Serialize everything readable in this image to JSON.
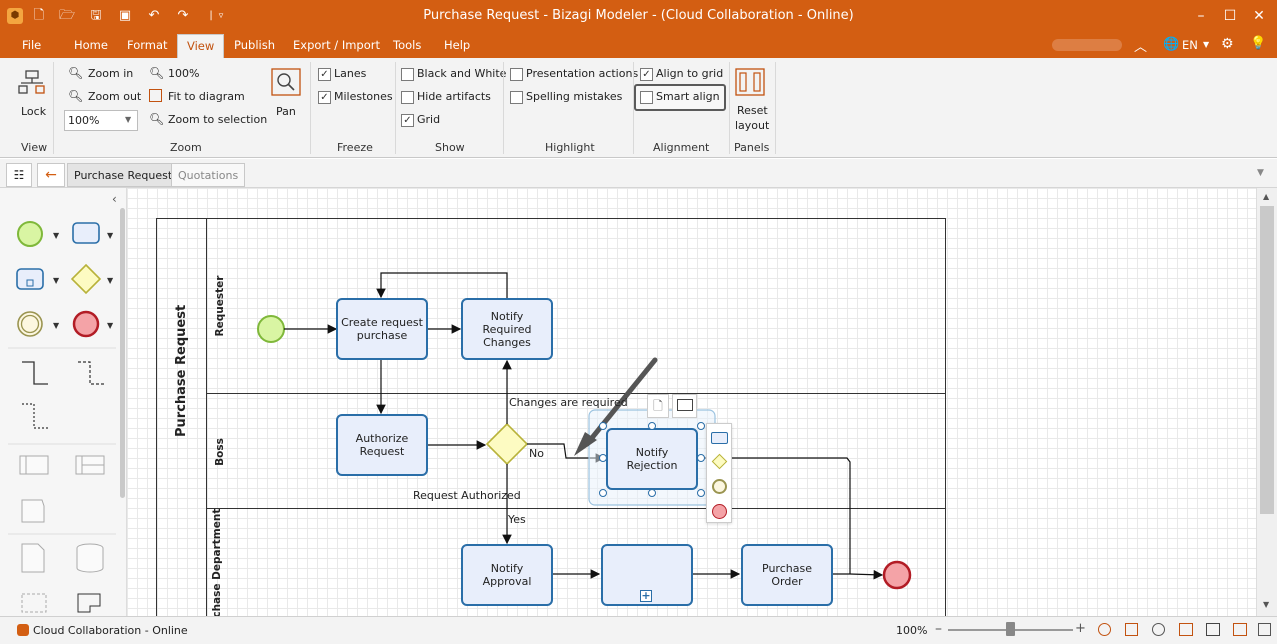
{
  "window": {
    "title": "Purchase Request - Bizagi Modeler - (Cloud Collaboration - Online)"
  },
  "menu": {
    "file": "File",
    "home": "Home",
    "format": "Format",
    "view": "View",
    "publish": "Publish",
    "export_import": "Export / Import",
    "tools": "Tools",
    "help": "Help",
    "language": "EN"
  },
  "ribbon": {
    "view_group": {
      "lock": "Lock",
      "label": "View"
    },
    "zoom_group": {
      "zoom_in": "Zoom in",
      "zoom_out": "Zoom out",
      "zoom_value": "100%",
      "hundred": "100%",
      "fit": "Fit to diagram",
      "zoom_selection": "Zoom to selection",
      "pan": "Pan",
      "label": "Zoom"
    },
    "freeze_group": {
      "lanes": "Lanes",
      "milestones": "Milestones",
      "label": "Freeze"
    },
    "show_group": {
      "bw": "Black and White",
      "hide_artifacts": "Hide artifacts",
      "grid": "Grid",
      "label": "Show"
    },
    "highlight_group": {
      "presentation": "Presentation actions",
      "spelling": "Spelling mistakes",
      "label": "Highlight"
    },
    "alignment_group": {
      "align_grid": "Align to grid",
      "smart_align": "Smart align",
      "label": "Alignment"
    },
    "panels_group": {
      "reset": "Reset",
      "layout": "layout",
      "label": "Panels"
    }
  },
  "tabs": {
    "purchase_request": "Purchase Request",
    "quotations": "Quotations"
  },
  "diagram": {
    "pool": "Purchase Request",
    "lane_requester": "Requester",
    "lane_boss": "Boss",
    "lane_purchase": "Purchase Department",
    "task_create": "Create request purchase",
    "task_notify_changes": "Notify Required Changes",
    "task_authorize": "Authorize Request",
    "task_notify_rejection": "Notify Rejection",
    "task_notify_approval": "Notify Approval",
    "task_purchase_order": "Purchase Order",
    "label_changes": "Changes are required",
    "label_no": "No",
    "label_authorized": "Request Authorized",
    "label_yes": "Yes"
  },
  "status": {
    "connection": "Cloud Collaboration - Online",
    "zoom": "100%"
  },
  "colors": {
    "accent": "#d35e12",
    "task_border": "#2a6ea8",
    "task_fill": "#e8eefb"
  }
}
